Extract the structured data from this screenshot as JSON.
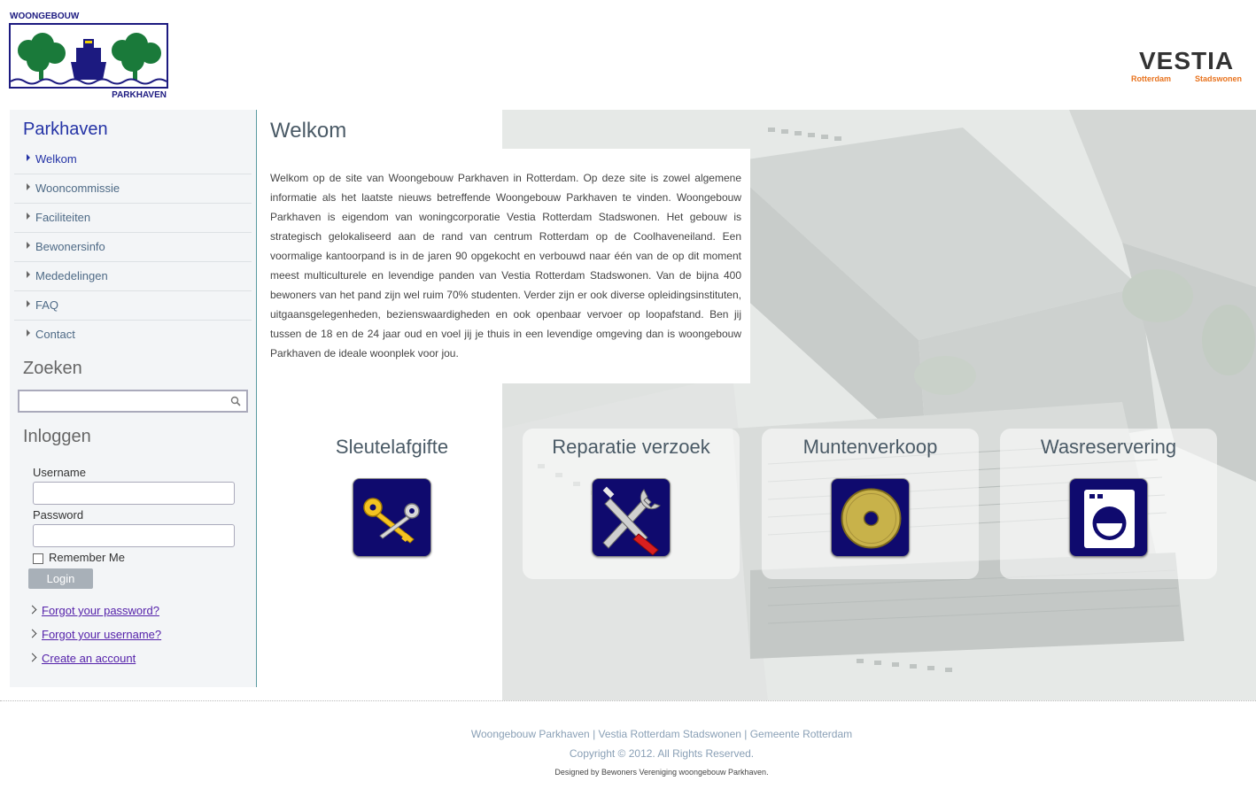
{
  "header": {
    "logo_left_text_top": "WOONGEBOUW",
    "logo_left_text_bottom": "PARKHAVEN",
    "logo_right_brand": "VESTIA",
    "logo_right_sub_left": "Rotterdam",
    "logo_right_sub_right": "Stadswonen"
  },
  "sidebar": {
    "title": "Parkhaven",
    "menu": [
      {
        "label": "Welkom",
        "active": true
      },
      {
        "label": "Wooncommissie"
      },
      {
        "label": "Faciliteiten"
      },
      {
        "label": "Bewonersinfo"
      },
      {
        "label": "Mededelingen"
      },
      {
        "label": "FAQ"
      },
      {
        "label": "Contact"
      }
    ],
    "search_heading": "Zoeken",
    "search_value": "",
    "login_heading": "Inloggen",
    "username_label": "Username",
    "username_value": "",
    "password_label": "Password",
    "password_value": "",
    "remember_label": "Remember Me",
    "remember_checked": false,
    "login_button": "Login",
    "links": [
      "Forgot your password?",
      "Forgot your username?",
      "Create an account"
    ]
  },
  "main": {
    "title": "Welkom",
    "text": "Welkom op de site van Woongebouw Parkhaven in Rotterdam. Op deze site is zowel algemene informatie als het laatste nieuws betreffende Woongebouw Parkhaven te vinden. Woongebouw Parkhaven is eigendom van woningcorporatie Vestia Rotterdam Stadswonen. Het gebouw is strategisch gelokaliseerd aan de rand van centrum Rotterdam op de Coolhaveneiland. Een voormalige kantoorpand is in de jaren 90 opgekocht en verbouwd naar één van de op dit moment meest multiculturele en levendige panden van Vestia Rotterdam Stadswonen. Van de bijna 400 bewoners van het pand zijn wel ruim 70% studenten. Verder zijn er ook diverse opleidingsinstituten, uitgaansgelegenheden, bezienswaardigheden en ook openbaar vervoer op loopafstand. Ben jij tussen de 18 en de 24 jaar oud en voel jij je thuis in een levendige omgeving dan is woongebouw Parkhaven de ideale woonplek voor jou.",
    "tiles": [
      {
        "title": "Sleutelafgifte",
        "icon": "keys-icon"
      },
      {
        "title": "Reparatie verzoek",
        "icon": "tools-icon"
      },
      {
        "title": "Muntenverkoop",
        "icon": "coin-icon"
      },
      {
        "title": "Wasreservering",
        "icon": "washing-machine-icon"
      }
    ]
  },
  "footer": {
    "links": "Woongebouw Parkhaven | Vestia Rotterdam Stadswonen | Gemeente Rotterdam",
    "copyright": "Copyright © 2012. All Rights Reserved.",
    "designed_by": "Designed by Bewoners Vereniging woongebouw Parkhaven."
  },
  "colors": {
    "accent_blue": "#2433a6",
    "logo_green": "#1a7a3a",
    "logo_navy": "#1c1a80",
    "vestia_orange": "#e8731e",
    "tile_icon_bg": "#0f0a6e"
  }
}
